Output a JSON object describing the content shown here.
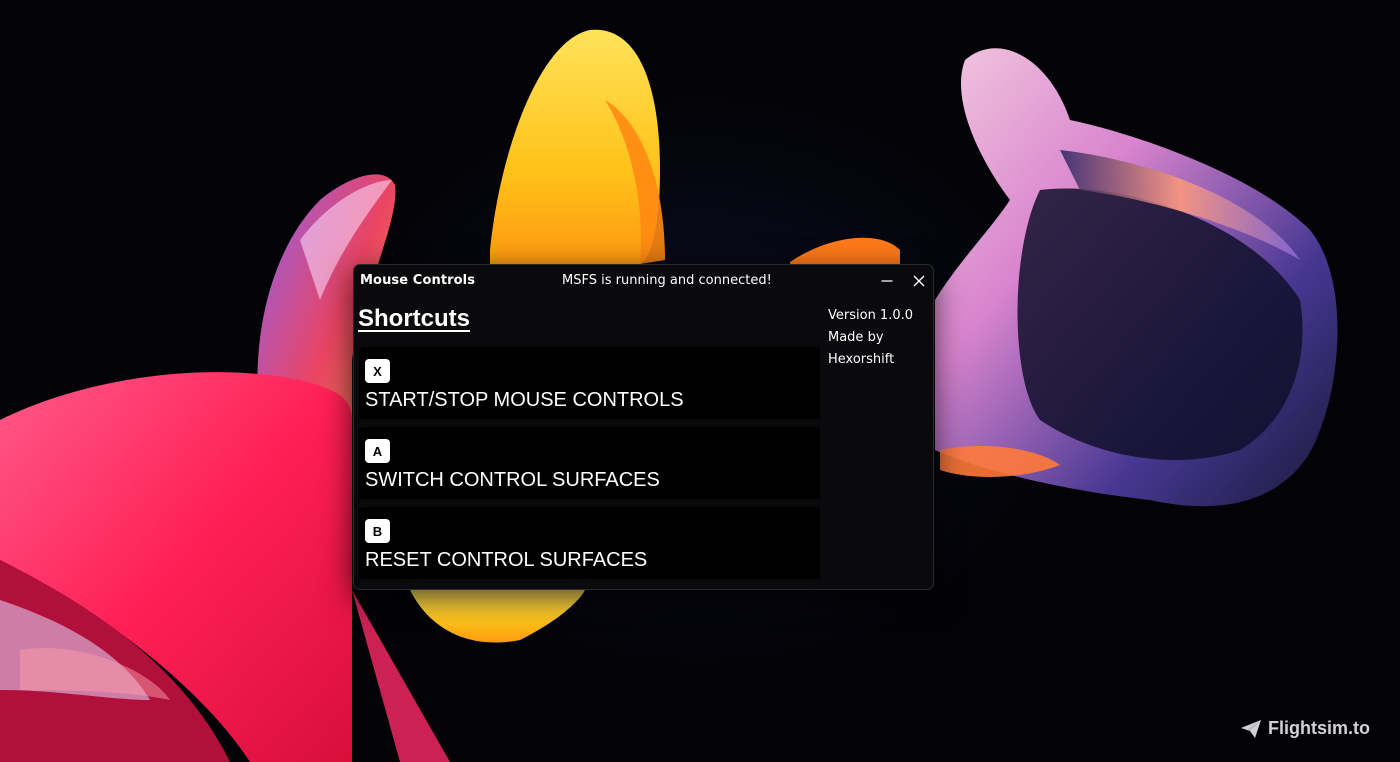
{
  "window": {
    "title": "Mouse Controls",
    "status": "MSFS is running and connected!"
  },
  "shortcuts": {
    "title": "Shortcuts",
    "items": [
      {
        "key": "X",
        "label": "START/STOP MOUSE CONTROLS"
      },
      {
        "key": "A",
        "label": "SWITCH CONTROL SURFACES"
      },
      {
        "key": "B",
        "label": "RESET CONTROL SURFACES"
      }
    ]
  },
  "info": {
    "version": "Version 1.0.0",
    "made_by": "Made by",
    "author": "Hexorshift"
  },
  "watermark": {
    "text": "Flightsim.to",
    "icon": "paper-plane-icon"
  },
  "icons": {
    "minimize": "minimize-icon",
    "close": "close-icon"
  },
  "colors": {
    "window_bg": "#0a090c",
    "card_bg": "#000000",
    "badge_bg": "#ffffff",
    "text": "#ffffff"
  }
}
